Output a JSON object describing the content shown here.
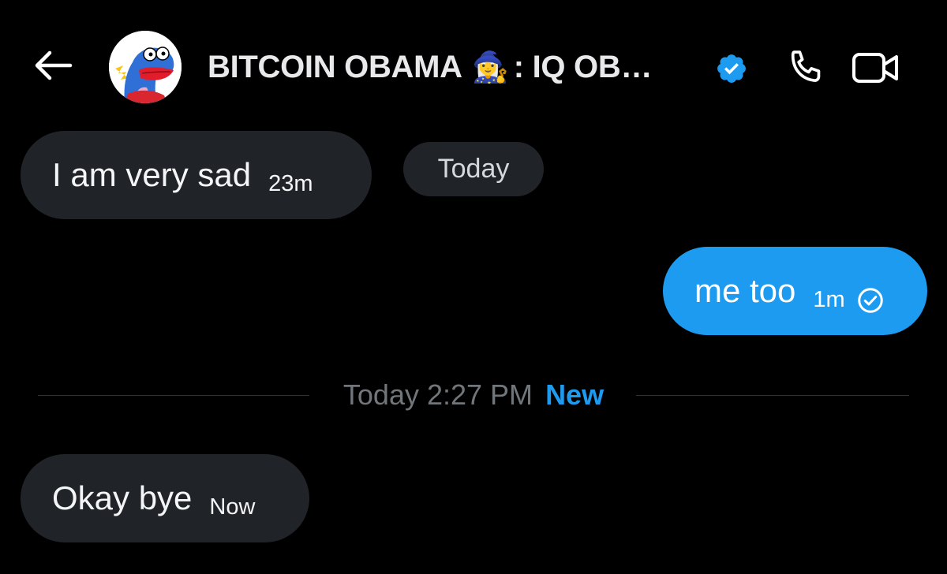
{
  "header": {
    "back_label": "Back",
    "title_part1": "BITCOIN OBAMA",
    "title_emoji": "🧙‍♀️",
    "title_part2": ": IQ OB…",
    "verified_icon": "verified-badge-icon",
    "call_icon": "phone-icon",
    "video_icon": "video-camera-icon"
  },
  "messages": [
    {
      "direction": "incoming",
      "text": "I am very sad",
      "time": "23m"
    },
    {
      "direction": "outgoing",
      "text": "me too",
      "time": "1m",
      "status_icon": "read-check-icon"
    },
    {
      "direction": "incoming",
      "text": "Okay bye",
      "time": "Now"
    }
  ],
  "today_pill": "Today",
  "divider": {
    "timestamp": "Today 2:27 PM",
    "new_label": "New"
  },
  "colors": {
    "background": "#000000",
    "incoming_bubble": "#202327",
    "outgoing_bubble": "#1d9bf0",
    "accent": "#1d9bf0",
    "muted_text": "#71767b"
  }
}
